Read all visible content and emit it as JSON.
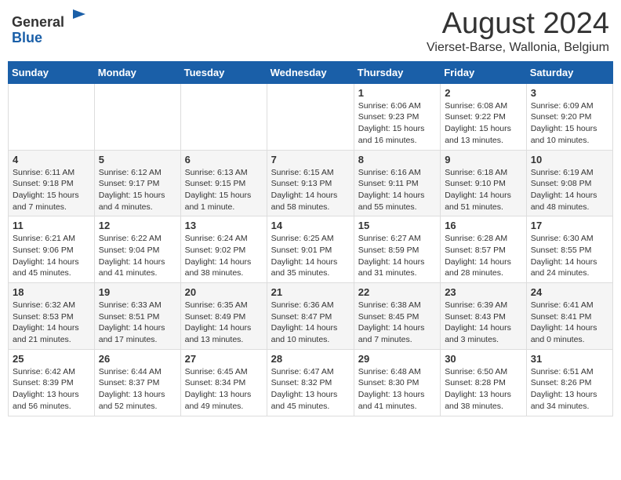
{
  "header": {
    "logo_general": "General",
    "logo_blue": "Blue",
    "month_title": "August 2024",
    "location": "Vierset-Barse, Wallonia, Belgium"
  },
  "weekdays": [
    "Sunday",
    "Monday",
    "Tuesday",
    "Wednesday",
    "Thursday",
    "Friday",
    "Saturday"
  ],
  "weeks": [
    [
      {
        "day": "",
        "info": ""
      },
      {
        "day": "",
        "info": ""
      },
      {
        "day": "",
        "info": ""
      },
      {
        "day": "",
        "info": ""
      },
      {
        "day": "1",
        "info": "Sunrise: 6:06 AM\nSunset: 9:23 PM\nDaylight: 15 hours\nand 16 minutes."
      },
      {
        "day": "2",
        "info": "Sunrise: 6:08 AM\nSunset: 9:22 PM\nDaylight: 15 hours\nand 13 minutes."
      },
      {
        "day": "3",
        "info": "Sunrise: 6:09 AM\nSunset: 9:20 PM\nDaylight: 15 hours\nand 10 minutes."
      }
    ],
    [
      {
        "day": "4",
        "info": "Sunrise: 6:11 AM\nSunset: 9:18 PM\nDaylight: 15 hours\nand 7 minutes."
      },
      {
        "day": "5",
        "info": "Sunrise: 6:12 AM\nSunset: 9:17 PM\nDaylight: 15 hours\nand 4 minutes."
      },
      {
        "day": "6",
        "info": "Sunrise: 6:13 AM\nSunset: 9:15 PM\nDaylight: 15 hours\nand 1 minute."
      },
      {
        "day": "7",
        "info": "Sunrise: 6:15 AM\nSunset: 9:13 PM\nDaylight: 14 hours\nand 58 minutes."
      },
      {
        "day": "8",
        "info": "Sunrise: 6:16 AM\nSunset: 9:11 PM\nDaylight: 14 hours\nand 55 minutes."
      },
      {
        "day": "9",
        "info": "Sunrise: 6:18 AM\nSunset: 9:10 PM\nDaylight: 14 hours\nand 51 minutes."
      },
      {
        "day": "10",
        "info": "Sunrise: 6:19 AM\nSunset: 9:08 PM\nDaylight: 14 hours\nand 48 minutes."
      }
    ],
    [
      {
        "day": "11",
        "info": "Sunrise: 6:21 AM\nSunset: 9:06 PM\nDaylight: 14 hours\nand 45 minutes."
      },
      {
        "day": "12",
        "info": "Sunrise: 6:22 AM\nSunset: 9:04 PM\nDaylight: 14 hours\nand 41 minutes."
      },
      {
        "day": "13",
        "info": "Sunrise: 6:24 AM\nSunset: 9:02 PM\nDaylight: 14 hours\nand 38 minutes."
      },
      {
        "day": "14",
        "info": "Sunrise: 6:25 AM\nSunset: 9:01 PM\nDaylight: 14 hours\nand 35 minutes."
      },
      {
        "day": "15",
        "info": "Sunrise: 6:27 AM\nSunset: 8:59 PM\nDaylight: 14 hours\nand 31 minutes."
      },
      {
        "day": "16",
        "info": "Sunrise: 6:28 AM\nSunset: 8:57 PM\nDaylight: 14 hours\nand 28 minutes."
      },
      {
        "day": "17",
        "info": "Sunrise: 6:30 AM\nSunset: 8:55 PM\nDaylight: 14 hours\nand 24 minutes."
      }
    ],
    [
      {
        "day": "18",
        "info": "Sunrise: 6:32 AM\nSunset: 8:53 PM\nDaylight: 14 hours\nand 21 minutes."
      },
      {
        "day": "19",
        "info": "Sunrise: 6:33 AM\nSunset: 8:51 PM\nDaylight: 14 hours\nand 17 minutes."
      },
      {
        "day": "20",
        "info": "Sunrise: 6:35 AM\nSunset: 8:49 PM\nDaylight: 14 hours\nand 13 minutes."
      },
      {
        "day": "21",
        "info": "Sunrise: 6:36 AM\nSunset: 8:47 PM\nDaylight: 14 hours\nand 10 minutes."
      },
      {
        "day": "22",
        "info": "Sunrise: 6:38 AM\nSunset: 8:45 PM\nDaylight: 14 hours\nand 7 minutes."
      },
      {
        "day": "23",
        "info": "Sunrise: 6:39 AM\nSunset: 8:43 PM\nDaylight: 14 hours\nand 3 minutes."
      },
      {
        "day": "24",
        "info": "Sunrise: 6:41 AM\nSunset: 8:41 PM\nDaylight: 14 hours\nand 0 minutes."
      }
    ],
    [
      {
        "day": "25",
        "info": "Sunrise: 6:42 AM\nSunset: 8:39 PM\nDaylight: 13 hours\nand 56 minutes."
      },
      {
        "day": "26",
        "info": "Sunrise: 6:44 AM\nSunset: 8:37 PM\nDaylight: 13 hours\nand 52 minutes."
      },
      {
        "day": "27",
        "info": "Sunrise: 6:45 AM\nSunset: 8:34 PM\nDaylight: 13 hours\nand 49 minutes."
      },
      {
        "day": "28",
        "info": "Sunrise: 6:47 AM\nSunset: 8:32 PM\nDaylight: 13 hours\nand 45 minutes."
      },
      {
        "day": "29",
        "info": "Sunrise: 6:48 AM\nSunset: 8:30 PM\nDaylight: 13 hours\nand 41 minutes."
      },
      {
        "day": "30",
        "info": "Sunrise: 6:50 AM\nSunset: 8:28 PM\nDaylight: 13 hours\nand 38 minutes."
      },
      {
        "day": "31",
        "info": "Sunrise: 6:51 AM\nSunset: 8:26 PM\nDaylight: 13 hours\nand 34 minutes."
      }
    ]
  ]
}
